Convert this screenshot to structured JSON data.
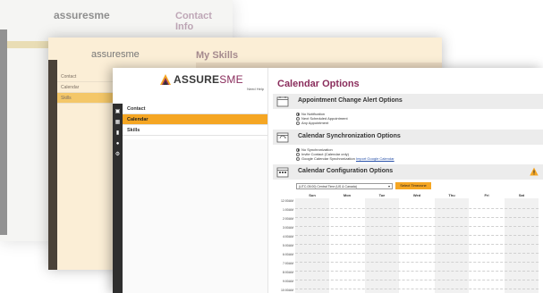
{
  "back_window": {
    "logo": "assuresme",
    "title": "Contact Info"
  },
  "middle_window": {
    "logo": "assuresme",
    "title": "My Skills",
    "menu": [
      {
        "label": "Contact",
        "active": false
      },
      {
        "label": "Calendar",
        "active": false
      },
      {
        "label": "Skills",
        "active": true
      }
    ]
  },
  "front_window": {
    "logo_main": "ASSURE",
    "logo_accent": "SME",
    "need_help": "Need Help",
    "nav": [
      {
        "label": "Contact",
        "active": false
      },
      {
        "label": "Calendar",
        "active": true
      },
      {
        "label": "Skills",
        "active": false
      }
    ],
    "sidebar_icons": [
      "address-card-icon",
      "calendar-icon",
      "bar-chart-icon",
      "tools-icon",
      "gear-icon"
    ],
    "page_title": "Calendar Options",
    "sections": {
      "alerts": {
        "title": "Appointment Change Alert Options",
        "options": [
          {
            "label": "No Notification",
            "selected": true
          },
          {
            "label": "Next Scheduled Appointment",
            "selected": false
          },
          {
            "label": "Any Appointment",
            "selected": false
          }
        ]
      },
      "sync": {
        "title": "Calendar Synchronization Options",
        "options": [
          {
            "label": "No Synchronization",
            "selected": true
          },
          {
            "label": "Invite Contact (Calendar only)",
            "selected": false
          },
          {
            "label": "Google Calendar Synchronization",
            "link": "Import Google Calendar",
            "selected": false
          }
        ]
      },
      "config": {
        "title": "Calendar Configuration Options",
        "timezone_value": "(UTC-05:00) Central Time (US & Canada)",
        "select_button": "Select Timezone"
      }
    },
    "calendar": {
      "days": [
        "Sun",
        "Mon",
        "Tue",
        "Wed",
        "Thu",
        "Fri",
        "Sat"
      ],
      "times": [
        "12:00AM",
        "1:00AM",
        "2:00AM",
        "3:00AM",
        "4:00AM",
        "5:00AM",
        "6:00AM",
        "7:00AM",
        "8:00AM",
        "9:00AM",
        "10:00AM"
      ]
    }
  },
  "colors": {
    "accent_orange": "#f5a623",
    "brand_purple": "#8a2d5c",
    "sidebar_dark": "#2e2e2e"
  }
}
